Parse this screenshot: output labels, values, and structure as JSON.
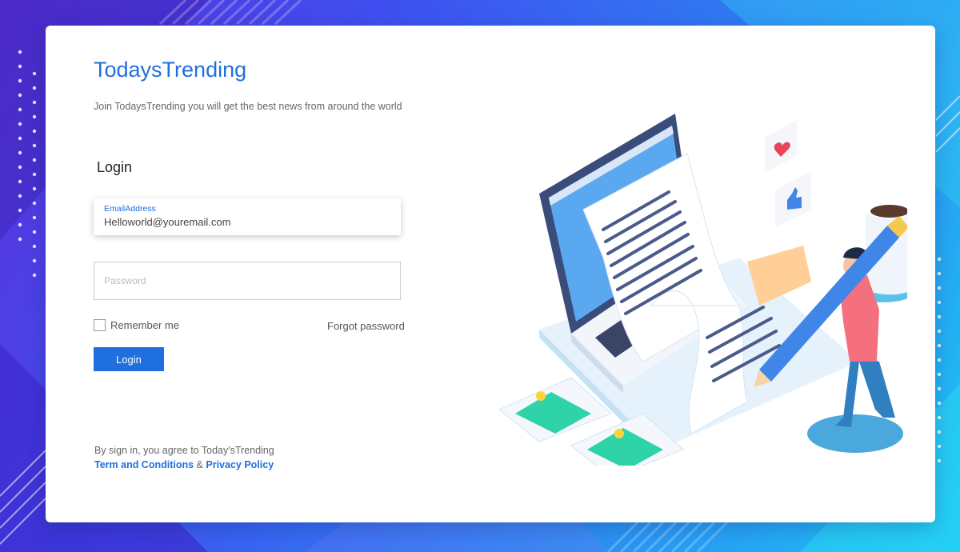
{
  "brand": {
    "name": "TodaysTrending",
    "tagline": "Join TodaysTrending you will get the best  news from around the world"
  },
  "form": {
    "heading": "Login",
    "email_label": "EmailAddress",
    "email_value": "Helloworld@youremail.com",
    "password_placeholder": "Password",
    "remember_label": "Remember me",
    "forgot_label": "Forgot password",
    "submit_label": "Login"
  },
  "legal": {
    "prefix": "By sign in, you agree to Today'sTrending",
    "terms": "Term and Conditions",
    "separator": " & ",
    "privacy": "Privacy Policy"
  },
  "colors": {
    "accent": "#1f6fde",
    "background_start": "#5b2fd8",
    "background_end": "#1ec4f5"
  },
  "icons": [
    "heart-icon",
    "thumbs-up-icon",
    "image-icon",
    "pencil-icon",
    "coffee-cup-icon"
  ]
}
